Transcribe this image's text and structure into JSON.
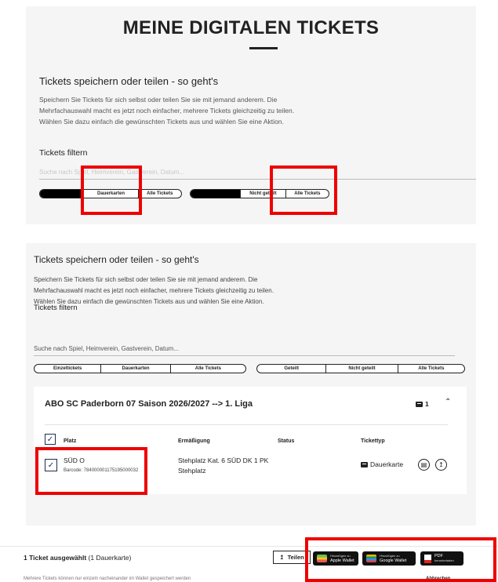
{
  "top_panel": {
    "title": "MEINE DIGITALEN TICKETS",
    "section_heading": "Tickets speichern oder teilen - so geht's",
    "description_lines": [
      "Speichern Sie Tickets für sich selbst oder teilen Sie sie mit jemand anderem. Die",
      "Mehrfachauswahl macht es jetzt noch einfacher, mehrere Tickets gleichzeitig zu teilen.",
      "Wählen Sie dazu einfach die gewünschten Tickets aus und wählen Sie eine Aktion."
    ],
    "filter_heading": "Tickets filtern",
    "search_placeholder": "Suche nach Spiel, Heimverein, Gastverein, Datum...",
    "type_filter": [
      "",
      "Dauerkarten",
      "Alle Tickets"
    ],
    "share_filter": [
      "",
      "Nicht geteilt",
      "Alle Tickets"
    ]
  },
  "bottom_panel": {
    "section_heading": "Tickets speichern oder teilen - so geht's",
    "description_lines": [
      "Speichern Sie Tickets für sich selbst oder teilen Sie sie mit jemand anderem. Die",
      "Mehrfachauswahl macht es jetzt noch einfacher, mehrere Tickets gleichzeitig zu teilen.",
      "Wählen Sie dazu einfach die gewünschten Tickets aus und wählen Sie eine Aktion."
    ],
    "filter_heading": "Tickets filtern",
    "search_placeholder": "Suche nach Spiel, Heimverein, Gastverein, Datum...",
    "type_filter": [
      "Einzeltickets",
      "Dauerkarten",
      "Alle Tickets"
    ],
    "share_filter": [
      "Geteilt",
      "Nicht geteilt",
      "Alle Tickets"
    ]
  },
  "ticket_card": {
    "title": "ABO SC Paderborn 07 Saison 2026/2027 --> 1. Liga",
    "count": "1",
    "columns": [
      "Platz",
      "Ermäßigung",
      "Status",
      "Tickettyp"
    ],
    "row": {
      "seat": "SÜD O",
      "barcode": "Barcode: 784000001175195000032",
      "discount_line1": "Stehplatz Kat. 6 SÜD DK 1 PK",
      "discount_line2": "Stehplatz",
      "status": "",
      "ticket_type": "Dauerkarte"
    }
  },
  "selection_bar": {
    "title": "1 Ticket ausgewählt",
    "subtitle": "(1 Dauerkarte)",
    "share_label": "Teilen",
    "apple_wallet_small": "Hinzufügen zu",
    "apple_wallet_big": "Apple Wallet",
    "google_wallet_small": "Hinzufügen zu",
    "google_wallet_big": "Google Wallet",
    "pdf_big": "PDF",
    "pdf_small": "herunterladen",
    "note": "Mehrere Tickets können nur einzeln nacheinander im Wallet gespeichert werden",
    "note_right": "Abbrechen"
  }
}
